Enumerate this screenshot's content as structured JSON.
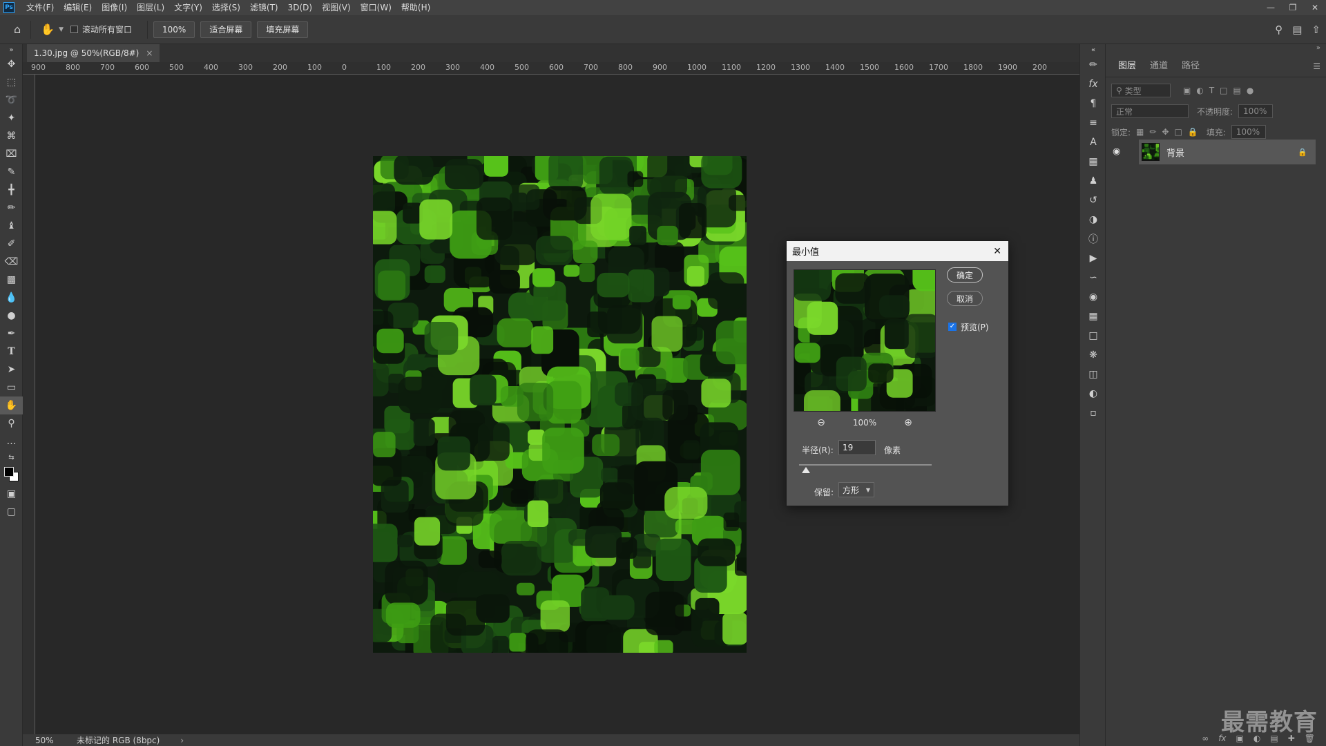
{
  "app": {
    "logo": "Ps"
  },
  "menu": [
    "文件(F)",
    "编辑(E)",
    "图像(I)",
    "图层(L)",
    "文字(Y)",
    "选择(S)",
    "滤镜(T)",
    "3D(D)",
    "视图(V)",
    "窗口(W)",
    "帮助(H)"
  ],
  "options_bar": {
    "scroll_all_label": "滚动所有窗口",
    "zoom_button": "100%",
    "fit_screen_button": "适合屏幕",
    "fill_screen_button": "填充屏幕"
  },
  "document": {
    "tab_title": "1.30.jpg @ 50%(RGB/8#)",
    "tab_close": "×",
    "zoom": "50%",
    "color_profile": "未标记的 RGB (8bpc)",
    "status_arrow": "›"
  },
  "ruler_ticks": [
    "900",
    "800",
    "700",
    "600",
    "500",
    "400",
    "300",
    "200",
    "100",
    "0",
    "100",
    "200",
    "300",
    "400",
    "500",
    "600",
    "700",
    "800",
    "900",
    "1000",
    "1100",
    "1200",
    "1300",
    "1400",
    "1500",
    "1600",
    "1700",
    "1800",
    "1900",
    "200"
  ],
  "layers_panel": {
    "tabs": [
      "图层",
      "通道",
      "路径"
    ],
    "filter_placeholder": "类型",
    "blend_mode": "正常",
    "opacity_label": "不透明度:",
    "opacity_value": "100%",
    "lock_label": "锁定:",
    "fill_label": "填充:",
    "fill_value": "100%",
    "layer_name": "背景"
  },
  "dialog": {
    "title": "最小值",
    "ok_button": "确定",
    "cancel_button": "取消",
    "preview_label": "预览(P)",
    "preview_checked": true,
    "zoom_level": "100%",
    "radius_label": "半径(R):",
    "radius_value": "19",
    "radius_unit": "像素",
    "radius_slider_fraction": 0.05,
    "preserve_label": "保留:",
    "preserve_value": "方形"
  },
  "watermark": "最需教育",
  "colors": {
    "accent": "#31a8ff",
    "image_green": "#3fae12",
    "panel_bg": "#3a3a3a"
  }
}
